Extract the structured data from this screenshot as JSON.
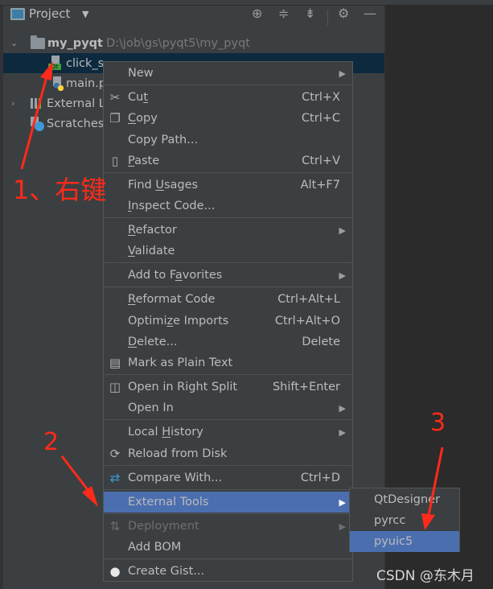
{
  "project_panel": {
    "title": "Project",
    "header_icons": [
      "locate-icon",
      "expand-all-icon",
      "collapse-all-icon",
      "gear-icon",
      "minimize-icon"
    ],
    "tree": [
      {
        "label": "my_pyqt",
        "path": "D:\\job\\gs\\pyqt5\\my_pyqt",
        "type": "folder",
        "expanded": true
      },
      {
        "label": "click_s",
        "type": "qt-ui-file",
        "selected": true
      },
      {
        "label": "main.p",
        "type": "python-file"
      },
      {
        "label": "External L",
        "type": "library",
        "expanded": false
      },
      {
        "label": "Scratches",
        "type": "scratches"
      }
    ]
  },
  "context_menu": {
    "items": [
      {
        "label_pre": "New",
        "label_u": "",
        "label_post": "",
        "shortcut": "",
        "submenu": true
      },
      {
        "label_pre": "Cu",
        "label_u": "t",
        "label_post": "",
        "shortcut": "Ctrl+X",
        "icon": "scissors-icon"
      },
      {
        "label_pre": "",
        "label_u": "C",
        "label_post": "opy",
        "shortcut": "Ctrl+C",
        "icon": "copy-icon"
      },
      {
        "label_pre": "Copy Path...",
        "label_u": "",
        "label_post": "",
        "shortcut": ""
      },
      {
        "label_pre": "",
        "label_u": "P",
        "label_post": "aste",
        "shortcut": "Ctrl+V",
        "icon": "paste-icon"
      },
      {
        "label_pre": "Find ",
        "label_u": "U",
        "label_post": "sages",
        "shortcut": "Alt+F7"
      },
      {
        "label_pre": "",
        "label_u": "I",
        "label_post": "nspect Code...",
        "shortcut": ""
      },
      {
        "label_pre": "",
        "label_u": "R",
        "label_post": "efactor",
        "shortcut": "",
        "submenu": true
      },
      {
        "label_pre": "",
        "label_u": "V",
        "label_post": "alidate",
        "shortcut": ""
      },
      {
        "label_pre": "Add to F",
        "label_u": "a",
        "label_post": "vorites",
        "shortcut": "",
        "submenu": true
      },
      {
        "label_pre": "",
        "label_u": "R",
        "label_post": "eformat Code",
        "shortcut": "Ctrl+Alt+L"
      },
      {
        "label_pre": "Optimi",
        "label_u": "z",
        "label_post": "e Imports",
        "shortcut": "Ctrl+Alt+O"
      },
      {
        "label_pre": "",
        "label_u": "D",
        "label_post": "elete...",
        "shortcut": "Delete"
      },
      {
        "label_pre": "Mark as Plain Text",
        "label_u": "",
        "label_post": "",
        "shortcut": "",
        "icon": "plain-text-icon"
      },
      {
        "label_pre": "Open in Right Split",
        "label_u": "",
        "label_post": "",
        "shortcut": "Shift+Enter",
        "icon": "split-icon"
      },
      {
        "label_pre": "Open In",
        "label_u": "",
        "label_post": "",
        "shortcut": "",
        "submenu": true
      },
      {
        "label_pre": "Local ",
        "label_u": "H",
        "label_post": "istory",
        "shortcut": "",
        "submenu": true
      },
      {
        "label_pre": "Reload from Disk",
        "label_u": "",
        "label_post": "",
        "shortcut": "",
        "icon": "reload-icon"
      },
      {
        "label_pre": "Compare With...",
        "label_u": "",
        "label_post": "",
        "shortcut": "Ctrl+D",
        "icon": "compare-icon"
      },
      {
        "label_pre": "External Tools",
        "label_u": "",
        "label_post": "",
        "shortcut": "",
        "submenu": true,
        "active": true
      },
      {
        "label_pre": "Deployment",
        "label_u": "",
        "label_post": "",
        "shortcut": "",
        "submenu": true,
        "disabled": true,
        "icon": "deployment-icon"
      },
      {
        "label_pre": "Add BOM",
        "label_u": "",
        "label_post": "",
        "shortcut": ""
      },
      {
        "label_pre": "Create Gist...",
        "label_u": "",
        "label_post": "",
        "shortcut": "",
        "icon": "github-icon"
      }
    ]
  },
  "external_tools_submenu": {
    "items": [
      {
        "label": "QtDesigner"
      },
      {
        "label": "pyrcc"
      },
      {
        "label": "pyuic5",
        "active": true
      }
    ]
  },
  "annotations": {
    "step1": "1、右键",
    "step2": "2",
    "step3": "3"
  },
  "watermark": "CSDN @东木月",
  "colors": {
    "panel_bg": "#3c3f41",
    "editor_bg": "#2b2b2b",
    "selection_bg": "#0d293e",
    "menu_active": "#4b6eaf",
    "annotation_red": "#ff2a1a"
  }
}
